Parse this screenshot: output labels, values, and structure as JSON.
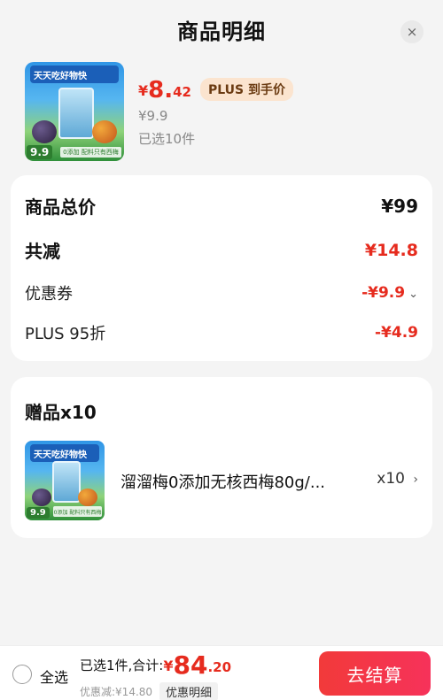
{
  "header": {
    "title": "商品明细",
    "close_icon": "×"
  },
  "product": {
    "thumb_banner": "天天吃好物快",
    "thumb_price": "9.9",
    "thumb_footer": "0添加 配料只有西梅",
    "price_yen": "¥",
    "price_int": "8.",
    "price_dec": "42",
    "plus_badge": "PLUS 到手价",
    "orig_price": "¥9.9",
    "selected": "已选10件"
  },
  "summary": {
    "total_label": "商品总价",
    "total_value": "¥99",
    "reduce_label": "共减",
    "reduce_value": "¥14.8",
    "coupon_label": "优惠券",
    "coupon_value": "-¥9.9",
    "plus_label": "PLUS 95折",
    "plus_value": "-¥4.9",
    "chevron": "⌄"
  },
  "gift": {
    "title": "赠品x10",
    "item_name": "溜溜梅0添加无核西梅80g/...",
    "item_qty": "x10",
    "chevron": "›"
  },
  "bottom": {
    "select_all": "全选",
    "summary_text": "已选1件,合计:",
    "total_yen": "¥",
    "total_int": "84",
    "total_dec": ".20",
    "discount_text": "优惠减:¥14.80",
    "detail_chip": "优惠明细",
    "checkout": "去结算"
  },
  "colors": {
    "accent": "#e62b1e",
    "button": "#f23a3a",
    "plus_badge_bg": "#fbe4cf"
  }
}
